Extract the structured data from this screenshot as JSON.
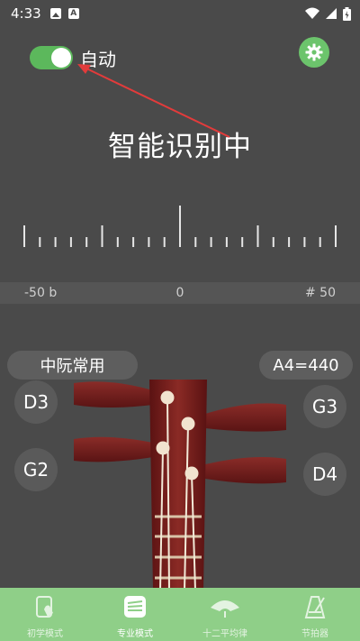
{
  "status_bar": {
    "time": "4:33"
  },
  "toggle": {
    "label": "自动",
    "on": true
  },
  "title": "智能识别中",
  "scale": {
    "min_label": "-50 b",
    "mid_label": "0",
    "max_label": "# 50"
  },
  "preset": {
    "instrument": "中阮常用",
    "pitch": "A4=440"
  },
  "strings": {
    "left_top": "D3",
    "left_bottom": "G2",
    "right_top": "G3",
    "right_bottom": "D4"
  },
  "nav": {
    "items": [
      {
        "label": "初学模式",
        "icon": "beginner-icon"
      },
      {
        "label": "专业模式",
        "icon": "pro-icon"
      },
      {
        "label": "十二平均律",
        "icon": "temperament-icon"
      },
      {
        "label": "节拍器",
        "icon": "metronome-icon"
      }
    ],
    "active_index": 1
  },
  "colors": {
    "accent": "#5cb85c",
    "nav_bg": "#8fcf88",
    "bg": "#4a4a4a",
    "wood": "#7a1e1e",
    "arrow": "#e23b3b"
  }
}
